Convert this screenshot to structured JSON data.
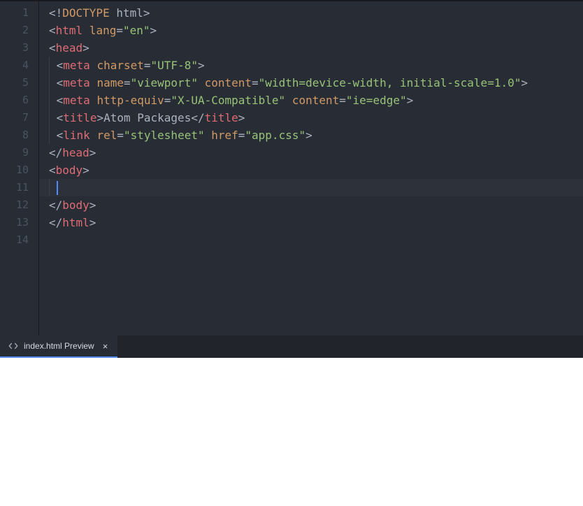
{
  "gutter": {
    "lines": [
      "1",
      "2",
      "3",
      "4",
      "5",
      "6",
      "7",
      "8",
      "9",
      "10",
      "11",
      "12",
      "13",
      "14"
    ]
  },
  "code": {
    "l1": {
      "a": "<!",
      "b": "DOCTYPE",
      "c": " html",
      "d": ">"
    },
    "l2": {
      "a": "<",
      "b": "html",
      "c": " ",
      "d": "lang",
      "e": "=",
      "f": "\"en\"",
      "g": ">"
    },
    "l3": {
      "a": "<",
      "b": "head",
      "c": ">"
    },
    "l4": {
      "a": "<",
      "b": "meta",
      "c": " ",
      "d": "charset",
      "e": "=",
      "f": "\"UTF-8\"",
      "g": ">"
    },
    "l5": {
      "a": "<",
      "b": "meta",
      "c": " ",
      "d": "name",
      "e": "=",
      "f": "\"viewport\"",
      "g": " ",
      "h": "content",
      "i": "=",
      "j": "\"width=device-width, initial-scale=1.0\"",
      "k": ">"
    },
    "l6": {
      "a": "<",
      "b": "meta",
      "c": " ",
      "d": "http-equiv",
      "e": "=",
      "f": "\"X-UA-Compatible\"",
      "g": " ",
      "h": "content",
      "i": "=",
      "j": "\"ie=edge\"",
      "k": ">"
    },
    "l7": {
      "a": "<",
      "b": "title",
      "c": ">",
      "d": "Atom Packages",
      "e": "</",
      "f": "title",
      "g": ">"
    },
    "l8": {
      "a": "<",
      "b": "link",
      "c": " ",
      "d": "rel",
      "e": "=",
      "f": "\"stylesheet\"",
      "g": " ",
      "h": "href",
      "i": "=",
      "j": "\"app.css\"",
      "k": ">"
    },
    "l9": {
      "a": "</",
      "b": "head",
      "c": ">"
    },
    "l10": {
      "a": "<",
      "b": "body",
      "c": ">"
    },
    "l12": {
      "a": "</",
      "b": "body",
      "c": ">"
    },
    "l13": {
      "a": "</",
      "b": "html",
      "c": ">"
    }
  },
  "preview": {
    "tab_label": "index.html Preview",
    "close": "×"
  }
}
